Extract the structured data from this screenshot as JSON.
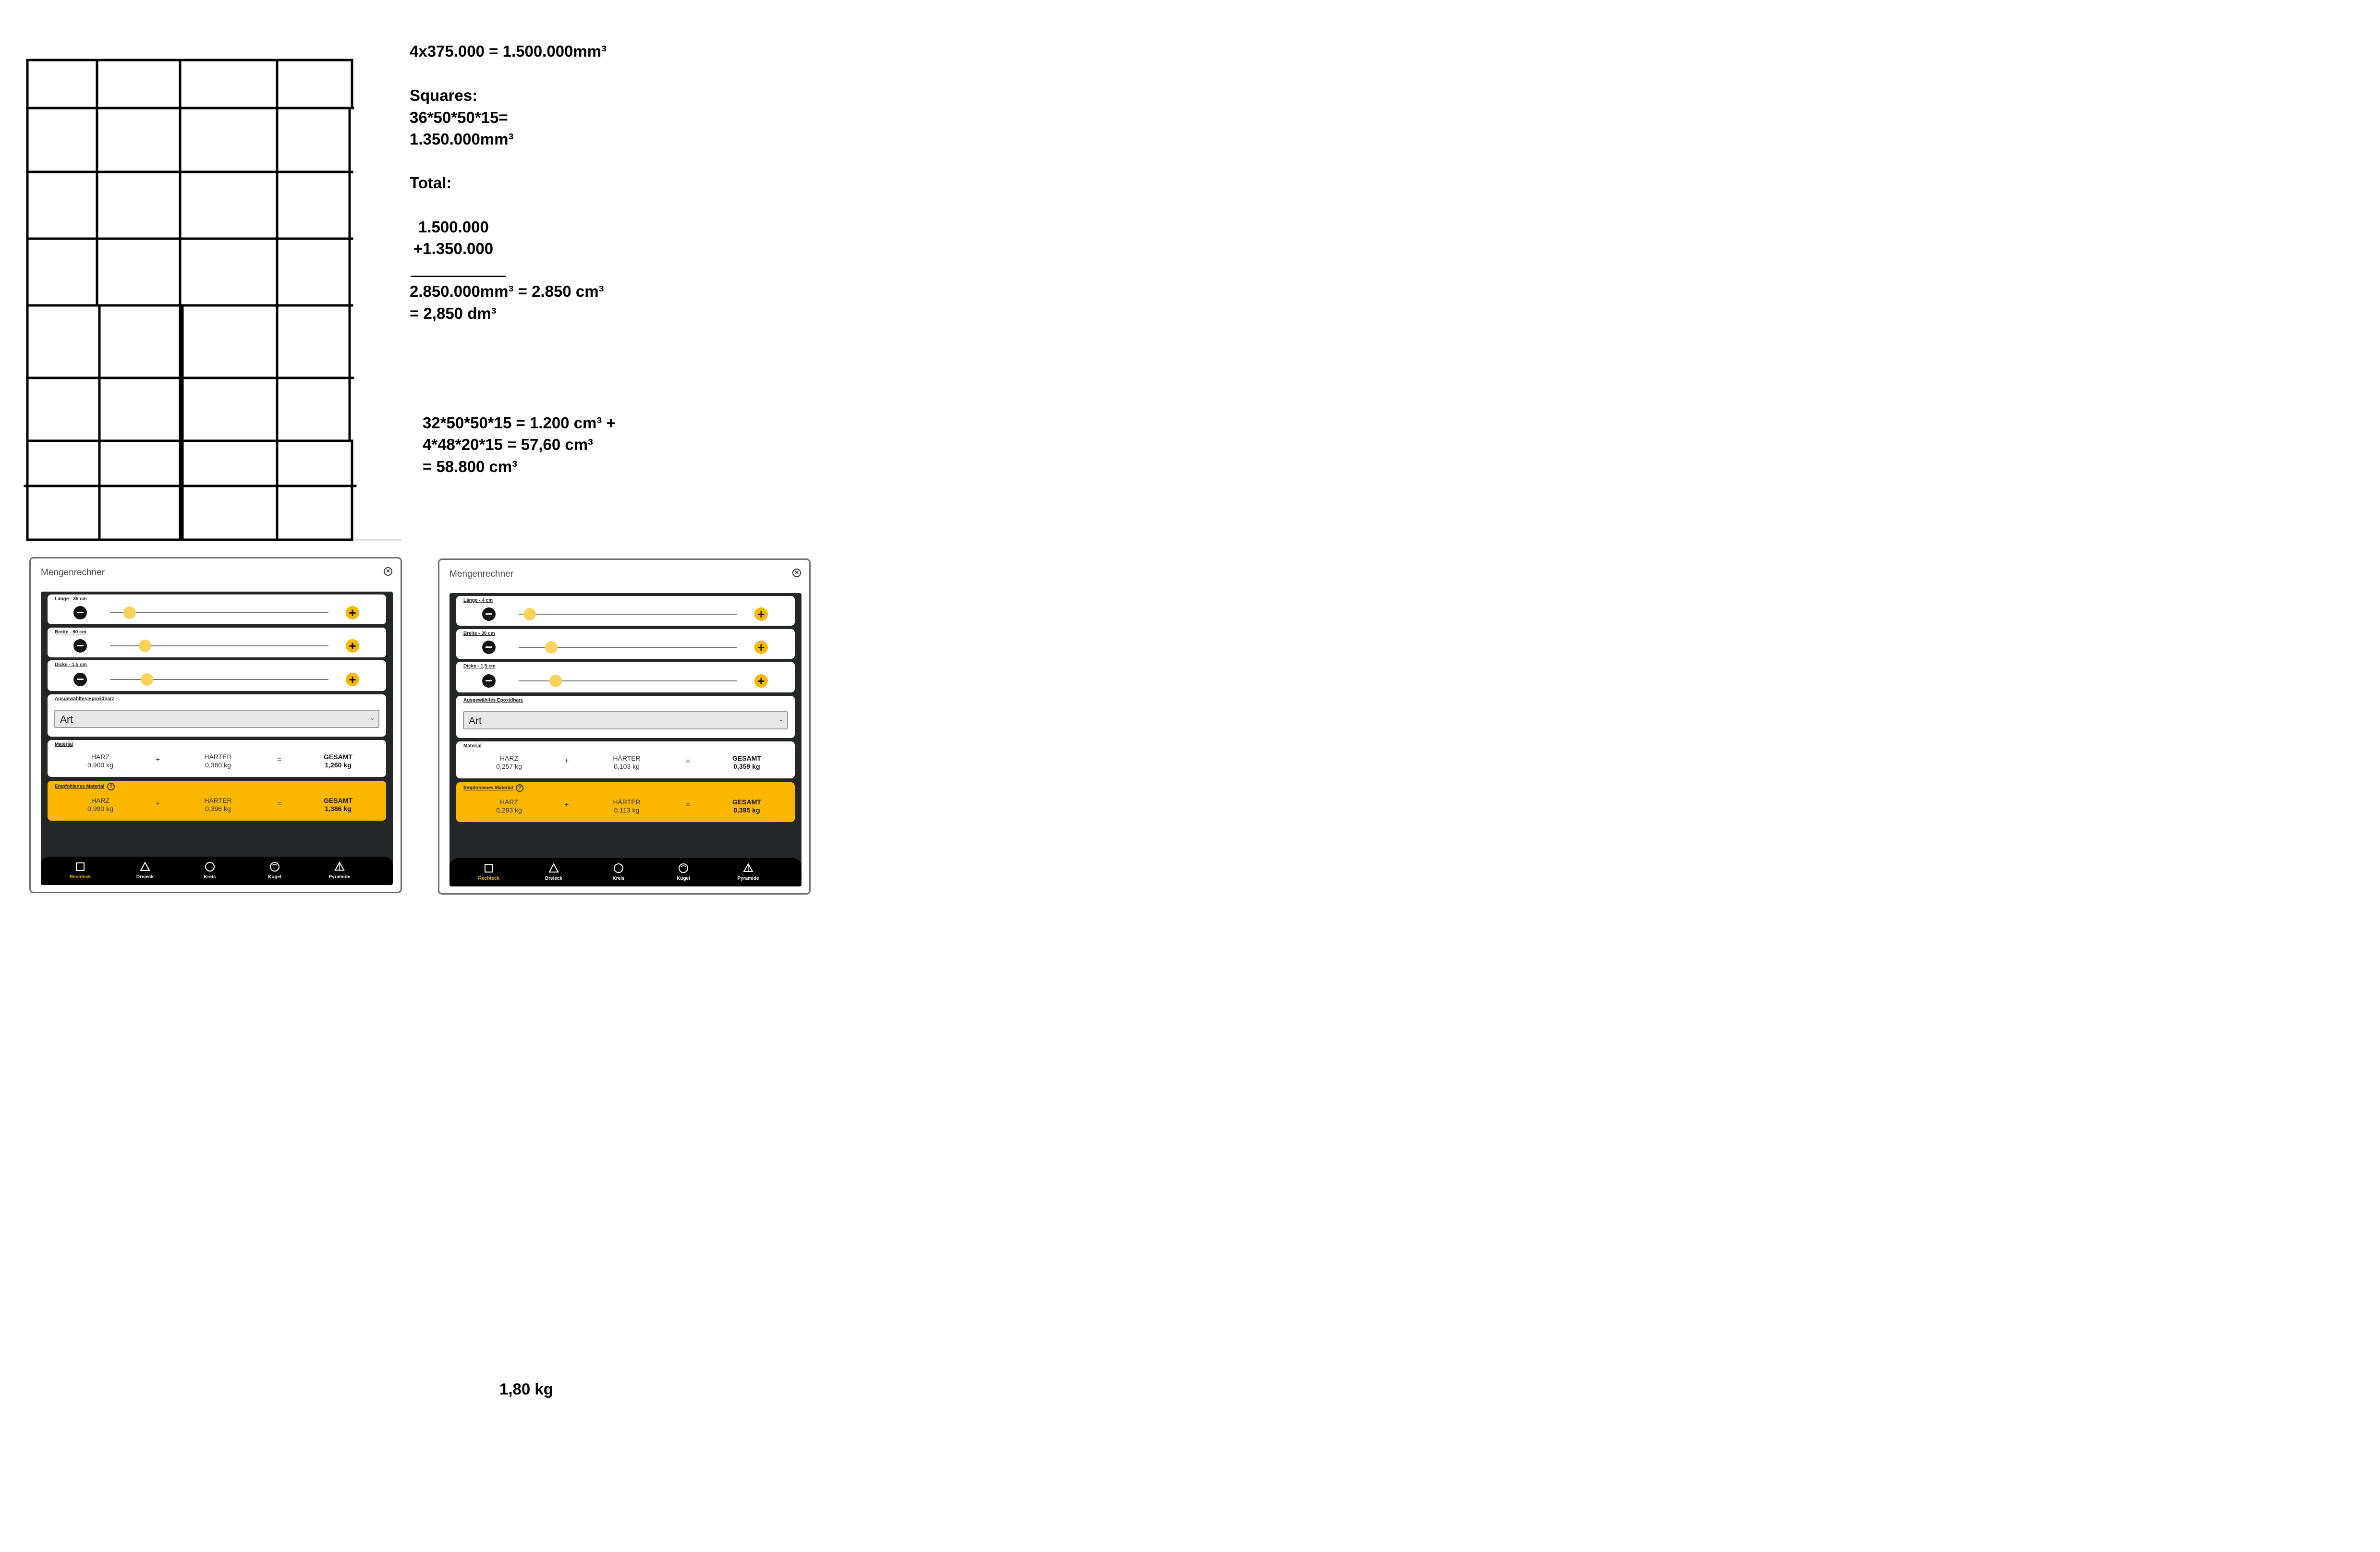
{
  "notes": {
    "line1": "4x375.000 = 1.500.000mm³",
    "line2": "Squares:",
    "line3": "36*50*50*15=",
    "line4": "1.350.000mm³",
    "line5": "Total:",
    "line6": "1.500.000",
    "line7": "+1.350.000",
    "line8": "2.850.000mm³ = 2.850 cm³",
    "line9": "= 2,850 dm³",
    "line10": "32*50*50*15 = 1.200 cm³ +",
    "line11": "4*48*20*15 = 57,60 cm³",
    "line12": "= 58.800 cm³",
    "bottom_result": "1,80 kg"
  },
  "calculators": [
    {
      "title": "Mengenrechner",
      "laenge_label": "Länge - 35 cm",
      "laenge_fraction": 0.09,
      "breite_label": "Breite - 90 cm",
      "breite_fraction": 0.16,
      "dicke_label": "Dicke - 1,5 cm",
      "dicke_fraction": 0.17,
      "resin_label": "Ausgewähltes Epoxidharz",
      "resin_value": "Art",
      "material_label": "Material",
      "harz_label": "HARZ",
      "harz_value": "0,900 kg",
      "haerter_label": "HÄRTER",
      "haerter_value": "0,360 kg",
      "gesamt_label": "GESAMT",
      "gesamt_value": "1,260 kg",
      "plus": "+",
      "equals": "=",
      "rec_label": "Empfohlenes Material",
      "rec_harz_label": "HARZ",
      "rec_harz_value": "0,990 kg",
      "rec_haerter_label": "HÄRTER",
      "rec_haerter_value": "0,396 kg",
      "rec_gesamt_label": "GESAMT",
      "rec_gesamt_value": "1,386 kg",
      "help": "?",
      "nav": [
        "Rechteck",
        "Dreieck",
        "Kreis",
        "Kugel",
        "Pyramide"
      ]
    },
    {
      "title": "Mengenrechner",
      "laenge_label": "Länge - 4 cm",
      "laenge_fraction": 0.05,
      "breite_label": "Breite - 30 cm",
      "breite_fraction": 0.15,
      "dicke_label": "Dicke - 1,5 cm",
      "dicke_fraction": 0.17,
      "resin_label": "Ausgewähltes Epoxidharz",
      "resin_value": "Art",
      "material_label": "Material",
      "harz_label": "HARZ",
      "harz_value": "0,257 kg",
      "haerter_label": "HÄRTER",
      "haerter_value": "0,103 kg",
      "gesamt_label": "GESAMT",
      "gesamt_value": "0,359 kg",
      "plus": "+",
      "equals": "=",
      "rec_label": "Empfohlenes Material",
      "rec_harz_label": "HARZ",
      "rec_harz_value": "0,283 kg",
      "rec_haerter_label": "HÄRTER",
      "rec_haerter_value": "0,113 kg",
      "rec_gesamt_label": "GESAMT",
      "rec_gesamt_value": "0,395 kg",
      "help": "?",
      "nav": [
        "Rechteck",
        "Dreieck",
        "Kreis",
        "Kugel",
        "Pyramide"
      ]
    }
  ]
}
